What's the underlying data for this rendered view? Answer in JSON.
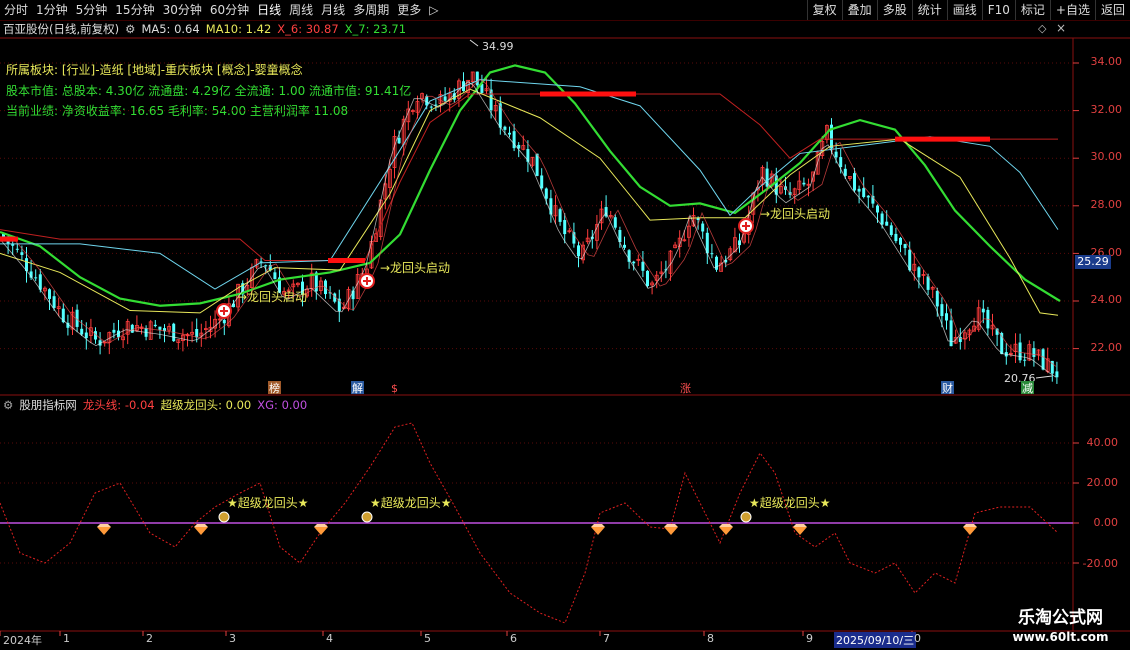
{
  "toolbar": {
    "tabs": [
      "分时",
      "1分钟",
      "5分钟",
      "15分钟",
      "30分钟",
      "60分钟",
      "日线",
      "周线",
      "月线",
      "多周期",
      "更多"
    ],
    "active_tab": "日线",
    "buttons": [
      "复权",
      "叠加",
      "多股",
      "统计",
      "画线",
      "F10",
      "标记",
      "+自选",
      "返回"
    ]
  },
  "header": {
    "stock": "百亚股份(日线,前复权)",
    "ma5": "MA5: 0.64",
    "ma10": "MA10: 1.42",
    "x6": "X_6: 30.87",
    "x7": "X_7: 23.71"
  },
  "info": {
    "line1_label": "所属板块:",
    "line1_value": "[行业]-造纸 [地域]-重庆板块 [概念]-婴童概念",
    "line2_label": "股本市值:",
    "line2_value": "总股本: 4.30亿 流通盘: 4.29亿 全流通: 1.00 流通市值: 91.41亿",
    "line3_label": "当前业绩:",
    "line3_value": "净资收益率: 16.65 毛利率: 54.00 主营利润率 11.08"
  },
  "price_axis": {
    "labels": [
      "34.00",
      "32.00",
      "30.00",
      "28.00",
      "26.00",
      "24.00",
      "22.00"
    ],
    "current_price": "25.29",
    "high_label": "34.99",
    "low_label": "20.76"
  },
  "annotations": {
    "signal_text": "龙回头启动",
    "badges": [
      "榜",
      "解",
      "$",
      "涨",
      "财",
      "减"
    ]
  },
  "indicator": {
    "name": "股朋指标网",
    "line1": "龙头线: -0.04",
    "line2": "超级龙回头: 0.00",
    "line3": "XG: 0.00",
    "signal_text": "★超级龙回头★",
    "axis_labels": [
      "40.00",
      "20.00",
      "0.00",
      "-20.00"
    ]
  },
  "date_axis": {
    "labels": [
      "2024年",
      "1",
      "2",
      "3",
      "4",
      "5",
      "6",
      "7",
      "8",
      "9",
      "2025/09/10/三",
      "0"
    ]
  },
  "watermark": {
    "title": "乐淘公式网",
    "url": "www.60lt.com"
  },
  "colors": {
    "up": "#ff3c3c",
    "down": "#54ffff",
    "ma_green": "#33dd33",
    "ma_yellow": "#e8e85a",
    "ma_red": "#e03030",
    "axis_red": "#e04040",
    "purple": "#c050e0"
  }
}
